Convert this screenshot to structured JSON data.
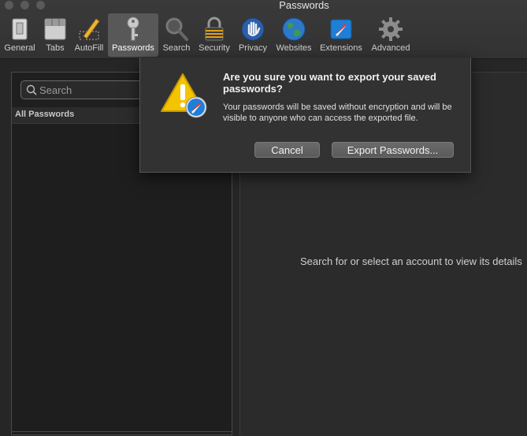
{
  "window": {
    "title": "Passwords"
  },
  "toolbar": {
    "items": [
      {
        "label": "General",
        "icon": "general-switch-icon"
      },
      {
        "label": "Tabs",
        "icon": "tabs-icon"
      },
      {
        "label": "AutoFill",
        "icon": "autofill-pencil-icon"
      },
      {
        "label": "Passwords",
        "icon": "key-icon",
        "active": true
      },
      {
        "label": "Search",
        "icon": "magnifier-icon"
      },
      {
        "label": "Security",
        "icon": "padlock-icon"
      },
      {
        "label": "Privacy",
        "icon": "hand-icon"
      },
      {
        "label": "Websites",
        "icon": "globe-icon"
      },
      {
        "label": "Extensions",
        "icon": "puzzle-compass-icon"
      },
      {
        "label": "Advanced",
        "icon": "gear-icon"
      }
    ]
  },
  "left_panel": {
    "search_placeholder": "Search",
    "list_header": "All Passwords"
  },
  "right_panel": {
    "hint": "Search for or select an account to view its details"
  },
  "dialog": {
    "title": "Are you sure you want to export your saved passwords?",
    "message": "Your passwords will be saved without encryption and will be visible to anyone who can access the exported file.",
    "cancel_label": "Cancel",
    "confirm_label": "Export Passwords..."
  },
  "colors": {
    "background": "#262626",
    "warning_yellow": "#f5c400",
    "safari_blue": "#1e7fd8"
  }
}
